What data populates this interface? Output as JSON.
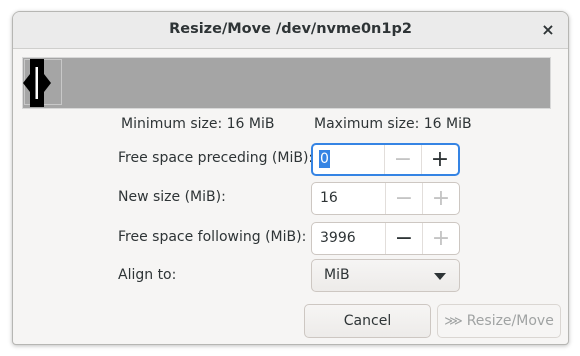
{
  "window": {
    "title": "Resize/Move /dev/nvme0n1p2",
    "close_glyph": "×"
  },
  "sizes": {
    "minimum": "Minimum size: 16 MiB",
    "maximum": "Maximum size: 16 MiB"
  },
  "fields": {
    "preceding": {
      "label": "Free space preceding (MiB):",
      "value": "0",
      "minus": "−",
      "plus": "+"
    },
    "new_size": {
      "label": "New size (MiB):",
      "value": "16",
      "minus": "−",
      "plus": "+"
    },
    "following": {
      "label": "Free space following (MiB):",
      "value": "3996",
      "minus": "−",
      "plus": "+"
    }
  },
  "align": {
    "label": "Align to:",
    "selected": "MiB"
  },
  "buttons": {
    "cancel": "Cancel",
    "resize_move": "Resize/Move",
    "resize_icon": "⋙"
  },
  "colors": {
    "accent": "#3584e4",
    "bar": "#a5a5a5",
    "handle": "#000000"
  }
}
